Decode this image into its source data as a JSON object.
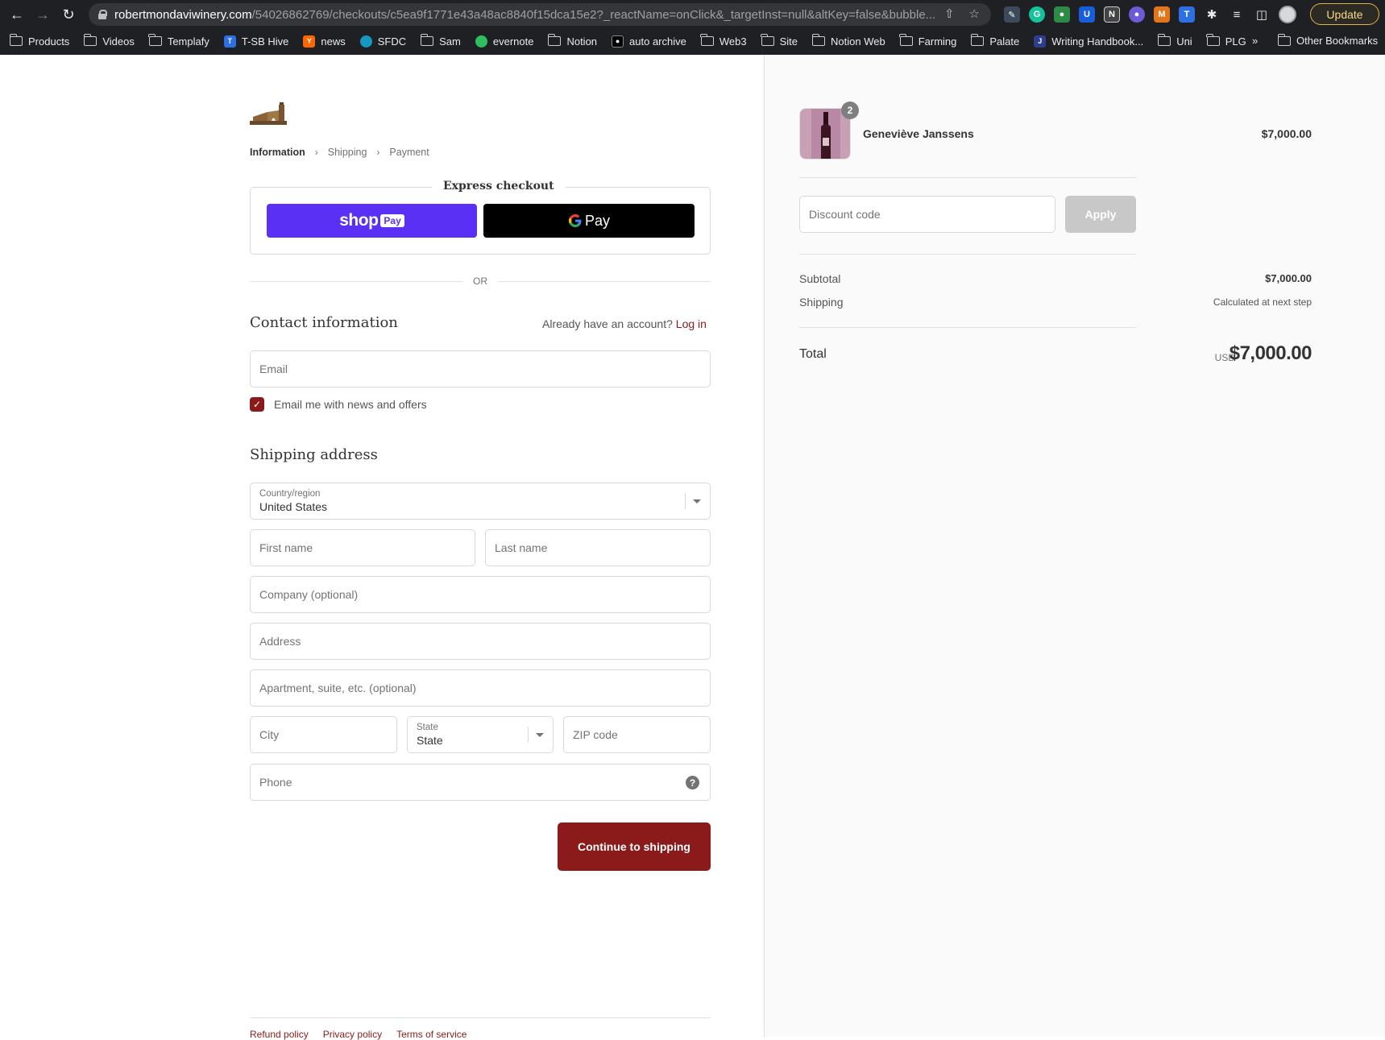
{
  "browser": {
    "url_host": "robertmondaviwinery.com",
    "url_path": "/54026862769/checkouts/c5ea9f1771e43a48ac8840f15dca15e2?_reactName=onClick&_targetInst=null&altKey=false&bubble...",
    "update_label": "Update",
    "bookmarks": [
      "Products",
      "Videos",
      "Templafy",
      "T-SB Hive",
      "news",
      "SFDC",
      "Sam",
      "evernote",
      "Notion",
      "auto archive",
      "Web3",
      "Site",
      "Notion Web",
      "Farming",
      "Palate",
      "Writing Handbook...",
      "Uni",
      "PLG"
    ],
    "bookmarks_more": "»",
    "other_bookmarks": "Other Bookmarks"
  },
  "checkout": {
    "breadcrumb": {
      "information": "Information",
      "shipping": "Shipping",
      "payment": "Payment"
    },
    "express_title": "Express checkout",
    "shop_pay": {
      "shop": "shop",
      "pay": "Pay"
    },
    "gpay_label": "Pay",
    "or_label": "OR",
    "contact_title": "Contact information",
    "account_prompt": "Already have an account?",
    "login_label": "Log in",
    "email_placeholder": "Email",
    "newsletter_label": "Email me with news and offers",
    "shipping_title": "Shipping address",
    "country_label": "Country/region",
    "country_value": "United States",
    "first_name_placeholder": "First name",
    "last_name_placeholder": "Last name",
    "company_placeholder": "Company (optional)",
    "address_placeholder": "Address",
    "apartment_placeholder": "Apartment, suite, etc. (optional)",
    "city_placeholder": "City",
    "state_label": "State",
    "state_value": "State",
    "zip_placeholder": "ZIP code",
    "phone_placeholder": "Phone",
    "continue_label": "Continue to shipping",
    "footer_links": [
      "Refund policy",
      "Privacy policy",
      "Terms of service"
    ]
  },
  "summary": {
    "product_name": "Geneviève Janssens",
    "product_qty": "2",
    "product_price": "$7,000.00",
    "discount_placeholder": "Discount code",
    "apply_label": "Apply",
    "subtotal_label": "Subtotal",
    "subtotal_value": "$7,000.00",
    "shipping_label": "Shipping",
    "shipping_value": "Calculated at next step",
    "total_label": "Total",
    "currency": "USD",
    "total_value": "$7,000.00"
  },
  "colors": {
    "accent": "#8b1a1a",
    "shop_pay": "#5a31f4"
  }
}
